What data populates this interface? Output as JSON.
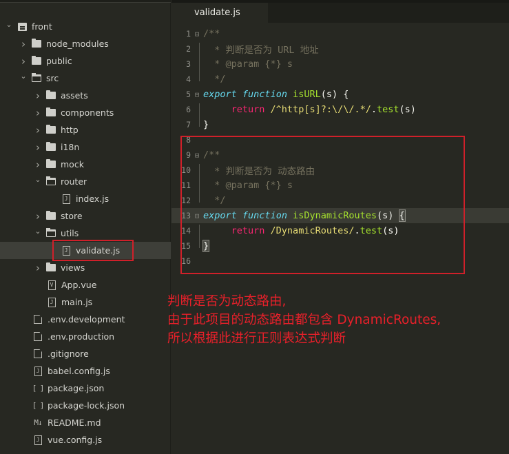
{
  "sidebar": {
    "items": [
      {
        "label": "front",
        "type": "root",
        "expanded": true,
        "depth": 0
      },
      {
        "label": "node_modules",
        "type": "folder",
        "expanded": false,
        "depth": 1
      },
      {
        "label": "public",
        "type": "folder",
        "expanded": false,
        "depth": 1
      },
      {
        "label": "src",
        "type": "folder",
        "expanded": true,
        "depth": 1
      },
      {
        "label": "assets",
        "type": "folder",
        "expanded": false,
        "depth": 2
      },
      {
        "label": "components",
        "type": "folder",
        "expanded": false,
        "depth": 2
      },
      {
        "label": "http",
        "type": "folder",
        "expanded": false,
        "depth": 2
      },
      {
        "label": "i18n",
        "type": "folder",
        "expanded": false,
        "depth": 2
      },
      {
        "label": "mock",
        "type": "folder",
        "expanded": false,
        "depth": 2
      },
      {
        "label": "router",
        "type": "folder",
        "expanded": true,
        "depth": 2
      },
      {
        "label": "index.js",
        "type": "js",
        "depth": 3
      },
      {
        "label": "store",
        "type": "folder",
        "expanded": false,
        "depth": 2
      },
      {
        "label": "utils",
        "type": "folder",
        "expanded": true,
        "depth": 2
      },
      {
        "label": "validate.js",
        "type": "js",
        "depth": 3,
        "selected": true
      },
      {
        "label": "views",
        "type": "folder",
        "expanded": false,
        "depth": 2
      },
      {
        "label": "App.vue",
        "type": "vue",
        "depth": 2
      },
      {
        "label": "main.js",
        "type": "js",
        "depth": 2
      },
      {
        "label": ".env.development",
        "type": "plain",
        "depth": 1
      },
      {
        "label": ".env.production",
        "type": "plain",
        "depth": 1
      },
      {
        "label": ".gitignore",
        "type": "plain",
        "depth": 1
      },
      {
        "label": "babel.config.js",
        "type": "js",
        "depth": 1
      },
      {
        "label": "package.json",
        "type": "json",
        "depth": 1
      },
      {
        "label": "package-lock.json",
        "type": "json",
        "depth": 1
      },
      {
        "label": "README.md",
        "type": "md",
        "depth": 1
      },
      {
        "label": "vue.config.js",
        "type": "js",
        "depth": 1
      }
    ],
    "icon_glyphs": {
      "js": "J",
      "vue": "V",
      "json": "[ ]",
      "md": "M↓"
    }
  },
  "editor": {
    "tab_label": "validate.js",
    "lines": [
      {
        "n": "1",
        "fold": "⊟",
        "tokens": [
          {
            "t": "/**",
            "c": "c-comment"
          }
        ]
      },
      {
        "n": "2",
        "fold": "",
        "tokens": [
          {
            "t": "  * 判断是否为 URL 地址",
            "c": "c-comment"
          }
        ]
      },
      {
        "n": "3",
        "fold": "",
        "tokens": [
          {
            "t": "  * @param {*} s",
            "c": "c-comment"
          }
        ]
      },
      {
        "n": "4",
        "fold": "",
        "tokens": [
          {
            "t": "  */",
            "c": "c-comment"
          }
        ]
      },
      {
        "n": "5",
        "fold": "⊟",
        "tokens": [
          {
            "t": "export",
            "c": "c-kw"
          },
          {
            "t": " ",
            "c": "c-plain"
          },
          {
            "t": "function",
            "c": "c-kw"
          },
          {
            "t": " ",
            "c": "c-plain"
          },
          {
            "t": "isURL",
            "c": "c-fn"
          },
          {
            "t": "(s) {",
            "c": "c-plain"
          }
        ]
      },
      {
        "n": "6",
        "fold": "",
        "tokens": [
          {
            "t": "     ",
            "c": "c-plain"
          },
          {
            "t": "return",
            "c": "c-ret"
          },
          {
            "t": " /^http[s]?:\\/\\/.*/",
            "c": "c-str"
          },
          {
            "t": ".",
            "c": "c-plain"
          },
          {
            "t": "test",
            "c": "c-fn"
          },
          {
            "t": "(s)",
            "c": "c-plain"
          }
        ]
      },
      {
        "n": "7",
        "fold": "",
        "tokens": [
          {
            "t": "}",
            "c": "c-plain"
          }
        ]
      },
      {
        "n": "8",
        "fold": "",
        "tokens": []
      },
      {
        "n": "9",
        "fold": "⊟",
        "tokens": [
          {
            "t": "/**",
            "c": "c-comment"
          }
        ]
      },
      {
        "n": "10",
        "fold": "",
        "tokens": [
          {
            "t": "  * 判断是否为 动态路由",
            "c": "c-comment"
          }
        ]
      },
      {
        "n": "11",
        "fold": "",
        "tokens": [
          {
            "t": "  * @param {*} s",
            "c": "c-comment"
          }
        ]
      },
      {
        "n": "12",
        "fold": "",
        "tokens": [
          {
            "t": "  */",
            "c": "c-comment"
          }
        ]
      },
      {
        "n": "13",
        "fold": "⊟",
        "current": true,
        "tokens": [
          {
            "t": "export",
            "c": "c-kw"
          },
          {
            "t": " ",
            "c": "c-plain"
          },
          {
            "t": "function",
            "c": "c-kw"
          },
          {
            "t": " ",
            "c": "c-plain"
          },
          {
            "t": "isDynamicRoutes",
            "c": "c-fn"
          },
          {
            "t": "(s) ",
            "c": "c-plain"
          },
          {
            "t": "{",
            "c": "c-plain bracket-match"
          }
        ]
      },
      {
        "n": "14",
        "fold": "",
        "tokens": [
          {
            "t": "     ",
            "c": "c-plain"
          },
          {
            "t": "return",
            "c": "c-ret"
          },
          {
            "t": " /DynamicRoutes/",
            "c": "c-str"
          },
          {
            "t": ".",
            "c": "c-plain"
          },
          {
            "t": "test",
            "c": "c-fn"
          },
          {
            "t": "(s)",
            "c": "c-plain"
          }
        ]
      },
      {
        "n": "15",
        "fold": "",
        "tokens": [
          {
            "t": "}",
            "c": "c-plain bracket-match"
          }
        ]
      },
      {
        "n": "16",
        "fold": "",
        "tokens": []
      }
    ]
  },
  "annotation": {
    "lines": [
      "判断是否为动态路由,",
      "由于此项目的动态路由都包含 DynamicRoutes,",
      "所以根据此进行正则表达式判断"
    ]
  },
  "colors": {
    "background": "#272822",
    "highlight_red": "#d0202a",
    "keyword": "#66d9ef",
    "function": "#a6e22e",
    "return": "#f92672",
    "string": "#e6db74",
    "comment": "#75715e"
  }
}
